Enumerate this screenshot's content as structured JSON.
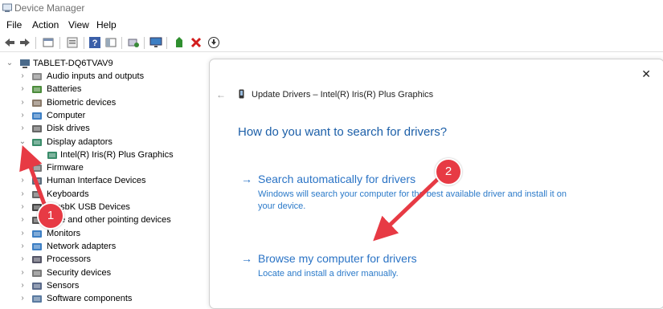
{
  "window": {
    "title": "Device Manager"
  },
  "menu": [
    "File",
    "Action",
    "View",
    "Help"
  ],
  "toolbar_icons": [
    "back-icon",
    "forward-icon",
    "properties-window-icon",
    "device-list-icon",
    "help-icon",
    "pane-icon",
    "scan-icon",
    "monitor-icon",
    "add-driver-icon",
    "uninstall-icon",
    "download-icon"
  ],
  "tree": {
    "root": "TABLET-DQ6TVAV9",
    "items": [
      {
        "label": "Audio inputs and outputs",
        "icon": "speaker-icon",
        "expanded": false
      },
      {
        "label": "Batteries",
        "icon": "battery-icon",
        "expanded": false
      },
      {
        "label": "Biometric devices",
        "icon": "fingerprint-icon",
        "expanded": false
      },
      {
        "label": "Computer",
        "icon": "computer-icon",
        "expanded": false
      },
      {
        "label": "Disk drives",
        "icon": "disk-icon",
        "expanded": false
      },
      {
        "label": "Display adaptors",
        "icon": "display-adapter-icon",
        "expanded": true
      },
      {
        "label": "Intel(R) Iris(R) Plus Graphics",
        "icon": "display-adapter-icon",
        "child": true
      },
      {
        "label": "Firmware",
        "icon": "firmware-icon",
        "expanded": false
      },
      {
        "label": "Human Interface Devices",
        "icon": "hid-icon",
        "expanded": false
      },
      {
        "label": "Keyboards",
        "icon": "keyboard-icon",
        "expanded": false
      },
      {
        "label": "libusbK USB Devices",
        "icon": "usb-icon",
        "expanded": false
      },
      {
        "label": "Mice and other pointing devices",
        "icon": "mouse-icon",
        "expanded": false
      },
      {
        "label": "Monitors",
        "icon": "monitor-icon",
        "expanded": false
      },
      {
        "label": "Network adapters",
        "icon": "network-icon",
        "expanded": false
      },
      {
        "label": "Processors",
        "icon": "processor-icon",
        "expanded": false
      },
      {
        "label": "Security devices",
        "icon": "security-icon",
        "expanded": false
      },
      {
        "label": "Sensors",
        "icon": "sensor-icon",
        "expanded": false
      },
      {
        "label": "Software components",
        "icon": "software-icon",
        "expanded": false
      }
    ]
  },
  "dialog": {
    "title": "Update Drivers – Intel(R) Iris(R) Plus Graphics",
    "heading": "How do you want to search for drivers?",
    "option1": {
      "title": "Search automatically for drivers",
      "desc": "Windows will search your computer for the best available driver and install it on your device."
    },
    "option2": {
      "title": "Browse my computer for drivers",
      "desc": "Locate and install a driver manually."
    }
  },
  "annotations": {
    "badge1": "1",
    "badge2": "2",
    "color": "#e73a44"
  }
}
